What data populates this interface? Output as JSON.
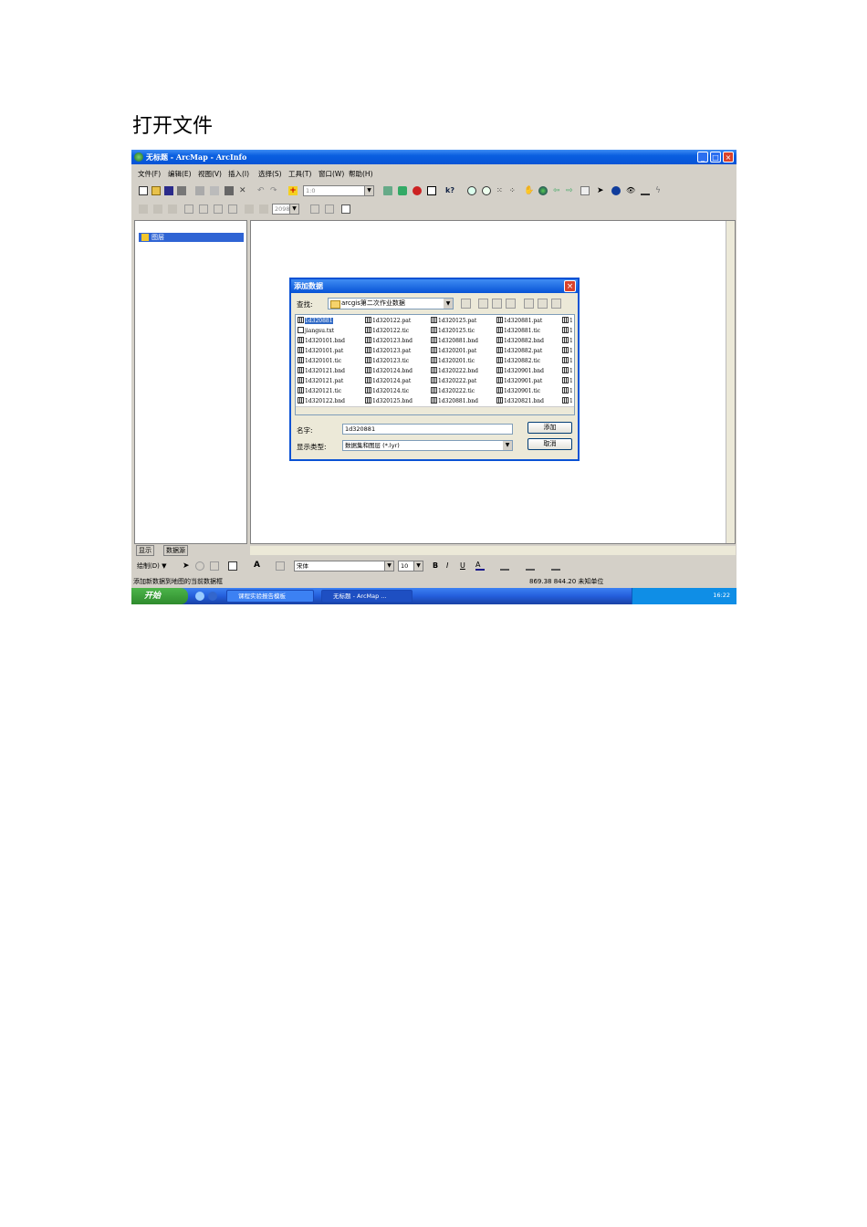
{
  "heading": "打开文件",
  "window": {
    "title": "无标题 - ArcMap - ArcInfo",
    "minimize": "_",
    "maximize": "□",
    "close": "×"
  },
  "menu": [
    "文件(F)",
    "编辑(E)",
    "视图(V)",
    "插入(I)",
    "选择(S)",
    "工具(T)",
    "窗口(W)",
    "帮助(H)"
  ],
  "toolbar": {
    "scale_value": "1:0",
    "combo2_value": "2098"
  },
  "toc": {
    "layers_label": "图层",
    "tab_display": "显示",
    "tab_source": "数据源"
  },
  "dialog": {
    "title": "添加数据",
    "look_in_label": "查找:",
    "look_in_value": "arcgis第二次作业数据",
    "name_label": "名字:",
    "name_value": "1d320881",
    "type_label": "显示类型:",
    "type_value": "数据集和图层 (*.lyr)",
    "add_button": "添加",
    "cancel_button": "取消",
    "files": [
      [
        "1d320881",
        "1d320122.pat",
        "1d320125.pat",
        "1d320881.pat",
        "1"
      ],
      [
        "jiangsu.txt",
        "1d320122.tic",
        "1d320125.tic",
        "1d320881.tic",
        "1"
      ],
      [
        "1d320101.bnd",
        "1d320123.bnd",
        "1d320881.bnd",
        "1d320882.bnd",
        "1"
      ],
      [
        "1d320101.pat",
        "1d320123.pat",
        "1d320201.pat",
        "1d320882.pat",
        "1"
      ],
      [
        "1d320101.tic",
        "1d320123.tic",
        "1d320201.tic",
        "1d320882.tic",
        "1"
      ],
      [
        "1d320121.bnd",
        "1d320124.bnd",
        "1d320222.bnd",
        "1d320901.bnd",
        "1"
      ],
      [
        "1d320121.pat",
        "1d320124.pat",
        "1d320222.pat",
        "1d320901.pat",
        "1"
      ],
      [
        "1d320121.tic",
        "1d320124.tic",
        "1d320222.tic",
        "1d320901.tic",
        "1"
      ],
      [
        "1d320122.bnd",
        "1d320125.bnd",
        "1d320881.bnd",
        "1d320821.bnd",
        "1"
      ]
    ]
  },
  "drawbar": {
    "draw_label": "绘制(D) ▼",
    "font_value": "宋体",
    "size_value": "10",
    "bold": "B",
    "italic": "I",
    "underline": "U"
  },
  "status": {
    "left": "添加新数据到地图的当前数据框",
    "right": "869.38  844.20 未知单位"
  },
  "taskbar": {
    "start": "开始",
    "task1": "课程实验报告模板",
    "task2": "无标题 - ArcMap ...",
    "clock": "16:22"
  }
}
